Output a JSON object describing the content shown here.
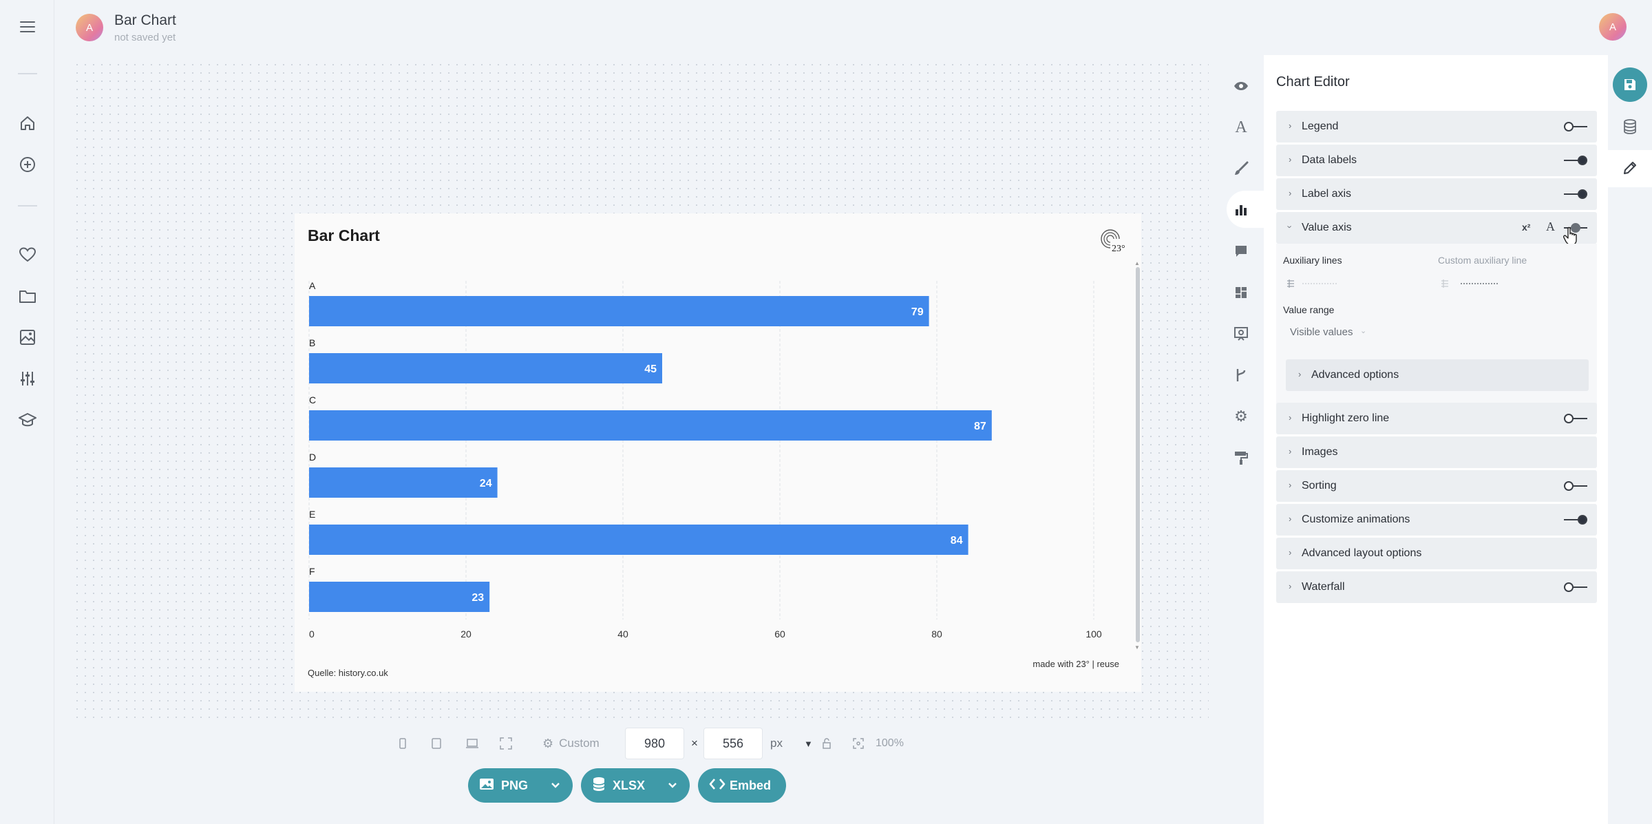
{
  "header": {
    "title": "Bar Chart",
    "subtitle": "not saved yet",
    "avatar_initial": "A",
    "user_avatar_initial": "A"
  },
  "left_nav": {
    "icons": [
      "menu-icon",
      "home-icon",
      "add-icon",
      "heart-icon",
      "folder-icon",
      "image-icon",
      "sliders-icon",
      "graduation-icon"
    ]
  },
  "chart_card": {
    "title": "Bar Chart",
    "source": "Quelle: history.co.uk",
    "made_with": "made with 23° | reuse",
    "logo_text": "23°"
  },
  "chart_data": {
    "type": "bar",
    "orientation": "horizontal",
    "categories": [
      "A",
      "B",
      "C",
      "D",
      "E",
      "F"
    ],
    "values": [
      79,
      45,
      87,
      24,
      84,
      23
    ],
    "xlim": [
      0,
      100
    ],
    "ticks": [
      "0",
      "20",
      "40",
      "60",
      "80",
      "100"
    ],
    "title": "Bar Chart",
    "xlabel": "",
    "ylabel": "",
    "color": "#4189ec",
    "grid": true,
    "data_labels": true
  },
  "size_toolbar": {
    "preset_label": "Custom",
    "width": "980",
    "height": "556",
    "times": "×",
    "unit": "px",
    "zoom": "100%"
  },
  "export": {
    "png_label": "PNG",
    "xlsx_label": "XLSX",
    "embed_label": "Embed",
    "color": "#3f9aa8"
  },
  "editor": {
    "title": "Chart Editor",
    "rows": [
      {
        "label": "Legend",
        "toggle": "off"
      },
      {
        "label": "Data labels",
        "toggle": "on"
      },
      {
        "label": "Label axis",
        "toggle": "on"
      },
      {
        "label": "Value axis",
        "toggle": "off",
        "expanded": true
      },
      {
        "label": "Highlight zero line",
        "toggle": "off"
      },
      {
        "label": "Images",
        "toggle": "none"
      },
      {
        "label": "Sorting",
        "toggle": "off"
      },
      {
        "label": "Customize animations",
        "toggle": "on"
      },
      {
        "label": "Advanced layout options",
        "toggle": "none"
      },
      {
        "label": "Waterfall",
        "toggle": "off"
      }
    ],
    "value_axis": {
      "superscript_label": "x²",
      "font_label": "A",
      "auxiliary_lines": "Auxiliary lines",
      "custom_auxiliary_line": "Custom auxiliary line",
      "value_range": "Value range",
      "value_range_selected": "Visible values",
      "advanced_options": "Advanced options"
    }
  }
}
